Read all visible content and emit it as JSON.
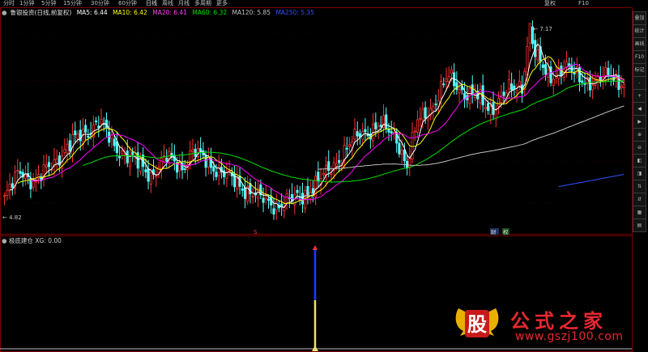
{
  "toolbar": {
    "period_tabs": [
      "分时",
      "1分钟",
      "5分钟",
      "15分钟",
      "30分钟",
      "60分钟",
      "日线",
      "周线",
      "月线",
      "多周期",
      "更多"
    ],
    "active_tab": "日线",
    "right_buttons": [
      "复权",
      "F10"
    ]
  },
  "main_legend": {
    "title": "鲁银投资(日线,前复权)",
    "ma5": "MA5: 6.44",
    "ma10": "MA10: 6.42",
    "ma20": "MA20: 6.41",
    "ma60": "MA60: 6.32",
    "ma120": "MA120: 5.85",
    "ma250": "MA250: 5.35"
  },
  "sub_legend": {
    "title": "极底建仓",
    "value": "XG: 0.00"
  },
  "price_labels": {
    "high": "7.17",
    "low": "4.82"
  },
  "markers": {
    "s_marker": "S",
    "fin_marker": "财",
    "rights_marker": "权"
  },
  "right_panel": [
    "叠加",
    "统计",
    "画线",
    "F10",
    "标记",
    "-",
    "+",
    "◀",
    "▶",
    "⊕",
    "⊖",
    "◧",
    "◨",
    "⇅",
    "⇵",
    "▦",
    "▤"
  ],
  "watermark": {
    "logo_char": "股",
    "title": "公式之家",
    "url": "www.gszj100.com"
  },
  "colors": {
    "up": "#ff3232",
    "up_hollow": "#ff5050",
    "down": "#54ffff",
    "ma5": "#ffffff",
    "ma10": "#ffff00",
    "ma20": "#ff00ff",
    "ma60": "#00e000",
    "ma120": "#c0c0c0",
    "ma250": "#3050ff"
  },
  "chart_data": {
    "type": "candlestick",
    "symbol": "鲁银投资",
    "period": "日线,前复权",
    "price_high": 7.17,
    "price_low": 4.82,
    "ma_last": {
      "MA5": 6.44,
      "MA10": 6.42,
      "MA20": 6.41,
      "MA60": 6.32,
      "MA120": 5.85,
      "MA250": 5.35
    },
    "subchart": {
      "name": "极底建仓",
      "XG": 0.0,
      "signal_index": 131
    }
  }
}
